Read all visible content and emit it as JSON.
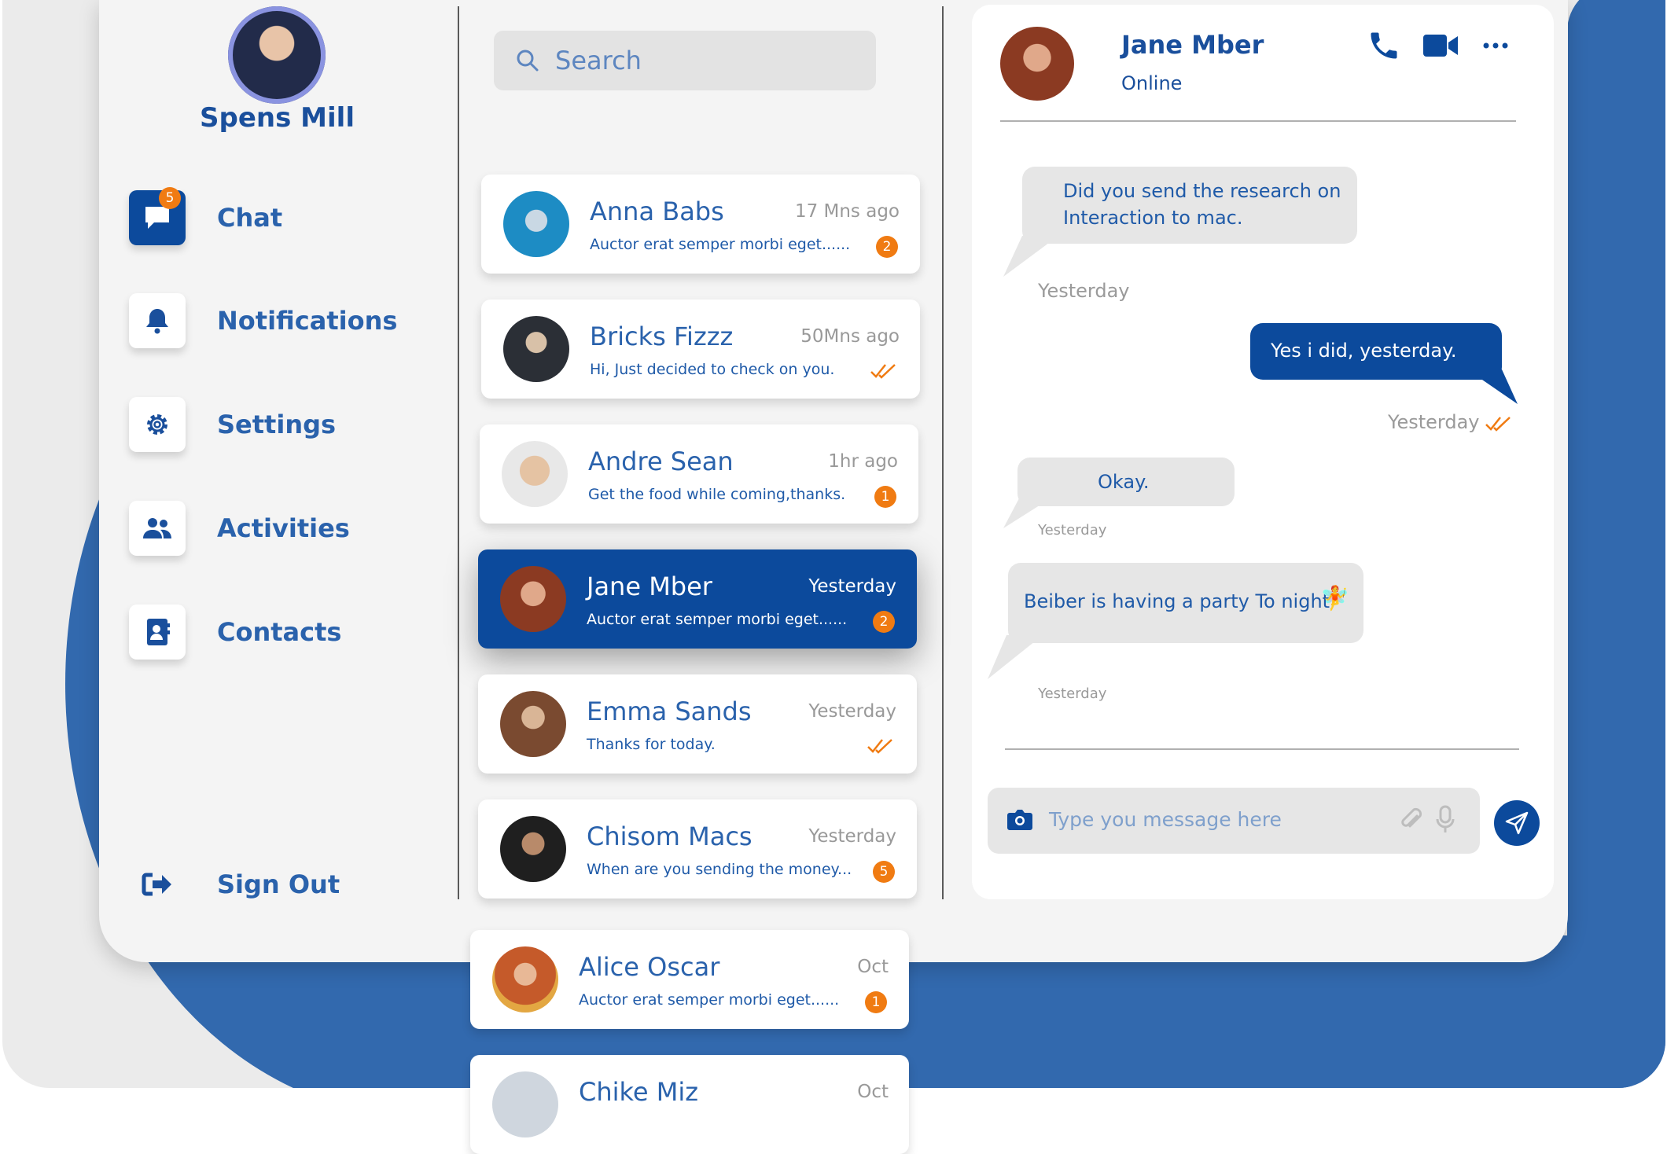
{
  "colors": {
    "primary": "#0c4a9c",
    "accent": "#f07b12",
    "background": "#3269ae",
    "panel": "#f4f4f4"
  },
  "profile": {
    "name": "Spens Mill"
  },
  "nav": [
    {
      "label": "Chat",
      "icon": "chat-icon",
      "badge": "5",
      "active": true
    },
    {
      "label": "Notifications",
      "icon": "bell-icon"
    },
    {
      "label": "Settings",
      "icon": "gear-icon"
    },
    {
      "label": "Activities",
      "icon": "users-icon"
    },
    {
      "label": "Contacts",
      "icon": "contact-book-icon"
    }
  ],
  "signout": {
    "label": "Sign Out",
    "icon": "sign-out-icon"
  },
  "search": {
    "placeholder": "Search"
  },
  "conversations": [
    {
      "name": "Anna Babs",
      "time": "17 Mns ago",
      "preview": "Auctor erat semper morbi eget......",
      "badge": "2"
    },
    {
      "name": "Bricks Fizzz",
      "time": "50Mns ago",
      "preview": "Hi, Just decided to check on you.",
      "read": true
    },
    {
      "name": "Andre Sean",
      "time": "1hr ago",
      "preview": "Get the food while coming,thanks.",
      "badge": "1"
    },
    {
      "name": "Jane Mber",
      "time": "Yesterday",
      "preview": "Auctor erat semper morbi eget......",
      "badge": "2",
      "active": true
    },
    {
      "name": "Emma Sands",
      "time": "Yesterday",
      "preview": "Thanks for today.",
      "read": true
    },
    {
      "name": "Chisom Macs",
      "time": "Yesterday",
      "preview": "When are you sending the money...",
      "badge": "5"
    },
    {
      "name": "Alice Oscar",
      "time": "Oct",
      "preview": "Auctor erat semper morbi eget......",
      "badge": "1"
    },
    {
      "name": "Chike Miz",
      "time": "Oct"
    }
  ],
  "chat": {
    "contact_name": "Jane Mber",
    "status": "Online",
    "messages": [
      {
        "text": "Did you send the research on Interaction to mac.",
        "dir": "in",
        "time": "Yesterday"
      },
      {
        "text": "Yes i did, yesterday.",
        "dir": "out",
        "time": "Yesterday"
      },
      {
        "text": "Okay.",
        "dir": "in",
        "time": "Yesterday"
      },
      {
        "text": "Beiber is having a party To night",
        "dir": "in",
        "time": "Yesterday",
        "emoji": "🧚"
      }
    ],
    "composer_placeholder": "Type you message here"
  }
}
